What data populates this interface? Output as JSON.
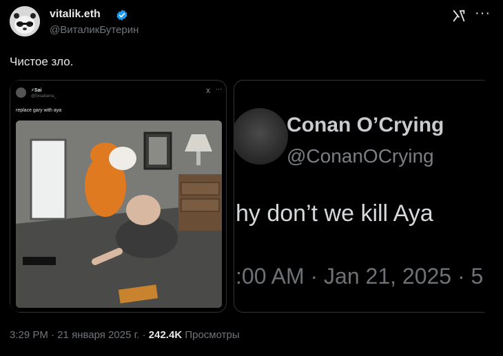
{
  "author": {
    "display_name": "vitalik.eth",
    "handle": "@ВиталикБутерин",
    "avatar_icon": "panda-avatar",
    "verified_icon": "verified-badge-icon",
    "verified_color": "#1d9bf0"
  },
  "header_actions": {
    "grok_icon": "grok-icon",
    "more_label": "···"
  },
  "tweet": {
    "text": "Чистое зло."
  },
  "media": [
    {
      "kind": "quoted-screenshot",
      "author_name": "⚡Sai",
      "author_handle": "@0xsaitama_",
      "text": "replace gary with aya",
      "x_label": "X",
      "more_label": "···"
    },
    {
      "kind": "quoted-screenshot",
      "author_name": "Conan O’Crying",
      "author_handle": "@ConanOCrying",
      "text": "hy don’t we kill Aya",
      "timestamp": ":00 AM · Jan 21, 2025 · 5"
    }
  ],
  "footer": {
    "time": "3:29 PM",
    "sep1": " · ",
    "date": "21 января 2025 г.",
    "sep2": " · ",
    "views_count": "242.4K",
    "views_label": " Просмотры"
  }
}
